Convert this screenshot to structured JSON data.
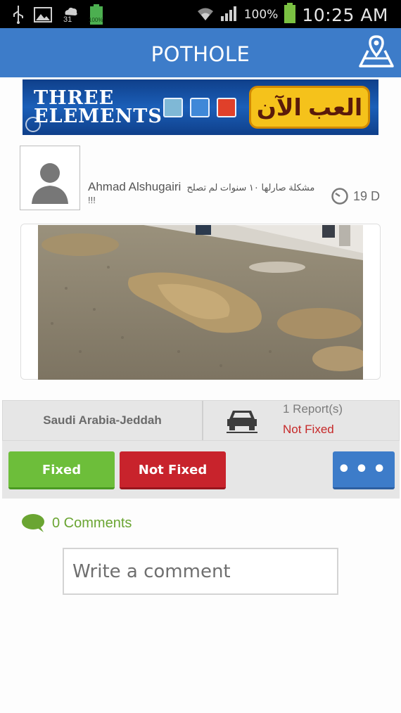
{
  "statusbar": {
    "usb_icon": "usb-icon",
    "gallery_icon": "image-icon",
    "weather_icon": "cloud-icon",
    "weather_value": "31",
    "battery_small_value": "100%",
    "wifi_icon": "wifi-icon",
    "signal_icon": "signal-icon",
    "battery_percent": "100%",
    "time": "10:25 AM"
  },
  "appbar": {
    "title": "POTHOLE",
    "map_icon": "map-pin-icon"
  },
  "ad": {
    "brand_line1": "THREE",
    "brand_line2": "ELEMENTS",
    "cta_label": "العب الآن",
    "tile_colors": [
      "#7fb8d6",
      "#3f88d8",
      "#e0402a"
    ]
  },
  "post": {
    "author": "Ahmad Alshugairi",
    "message": "مشكلة صارلها ١٠ سنوات لم تصلح !!!",
    "age": "19 D"
  },
  "info": {
    "location": "Saudi Arabia-Jeddah",
    "reports": "1 Report(s)",
    "status": "Not Fixed"
  },
  "actions": {
    "fixed_label": "Fixed",
    "not_fixed_label": "Not Fixed",
    "more_label": "•••"
  },
  "comments": {
    "count_label": "0 Comments",
    "placeholder": "Write a comment"
  },
  "colors": {
    "primary": "#3d7cc9",
    "fixed": "#6dbe3a",
    "not_fixed": "#c8232c",
    "comments_text": "#6aa532"
  }
}
